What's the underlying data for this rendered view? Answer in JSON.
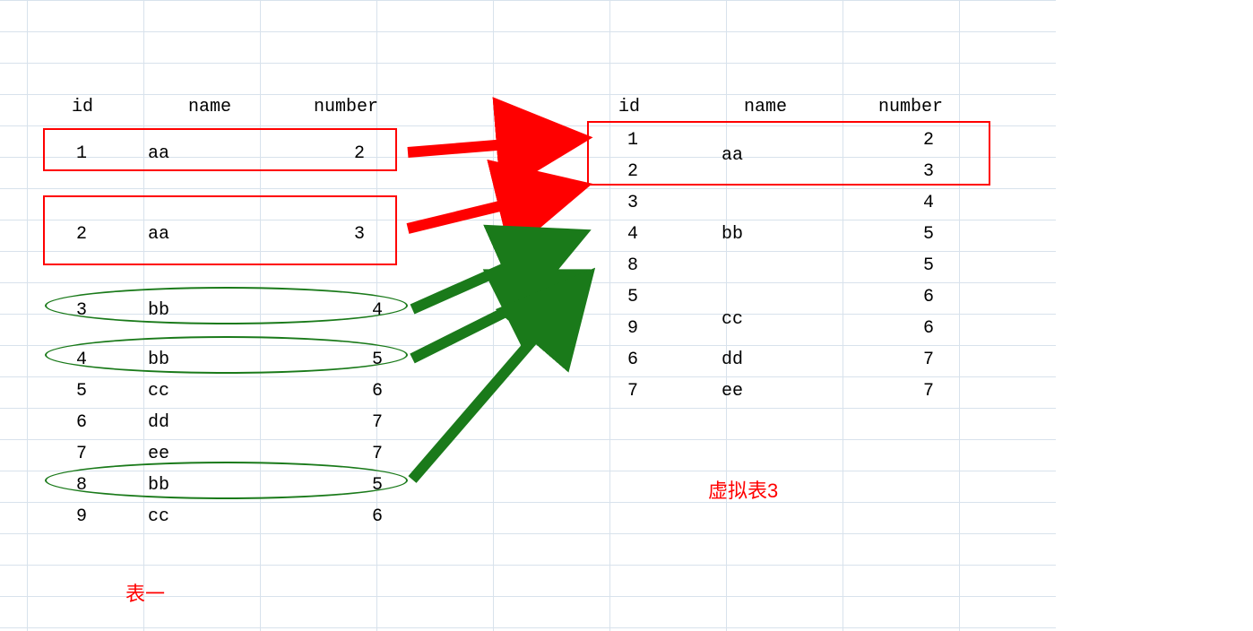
{
  "table1": {
    "headers": {
      "id": "id",
      "name": "name",
      "number": "number"
    },
    "rows": [
      {
        "id": "1",
        "name": "aa",
        "number": "2"
      },
      {
        "id": "2",
        "name": "aa",
        "number": "3"
      },
      {
        "id": "3",
        "name": "bb",
        "number": "4"
      },
      {
        "id": "4",
        "name": "bb",
        "number": "5"
      },
      {
        "id": "5",
        "name": "cc",
        "number": "6"
      },
      {
        "id": "6",
        "name": "dd",
        "number": "7"
      },
      {
        "id": "7",
        "name": "ee",
        "number": "7"
      },
      {
        "id": "8",
        "name": "bb",
        "number": "5"
      },
      {
        "id": "9",
        "name": "cc",
        "number": "6"
      }
    ],
    "label": "表一"
  },
  "table3": {
    "headers": {
      "id": "id",
      "name": "name",
      "number": "number"
    },
    "rows": [
      {
        "id": "1",
        "name": "",
        "number": "2"
      },
      {
        "id": "2",
        "name": "aa",
        "number": "3"
      },
      {
        "id": "3",
        "name": "",
        "number": "4"
      },
      {
        "id": "4",
        "name": "bb",
        "number": "5"
      },
      {
        "id": "8",
        "name": "",
        "number": "5"
      },
      {
        "id": "5",
        "name": "",
        "number": "6"
      },
      {
        "id": "9",
        "name": "cc",
        "number": "6"
      },
      {
        "id": "6",
        "name": "dd",
        "number": "7"
      },
      {
        "id": "7",
        "name": "ee",
        "number": "7"
      }
    ],
    "merged_names": {
      "group1": "aa",
      "group2": "bb",
      "group3": "cc"
    },
    "label": "虚拟表3"
  }
}
